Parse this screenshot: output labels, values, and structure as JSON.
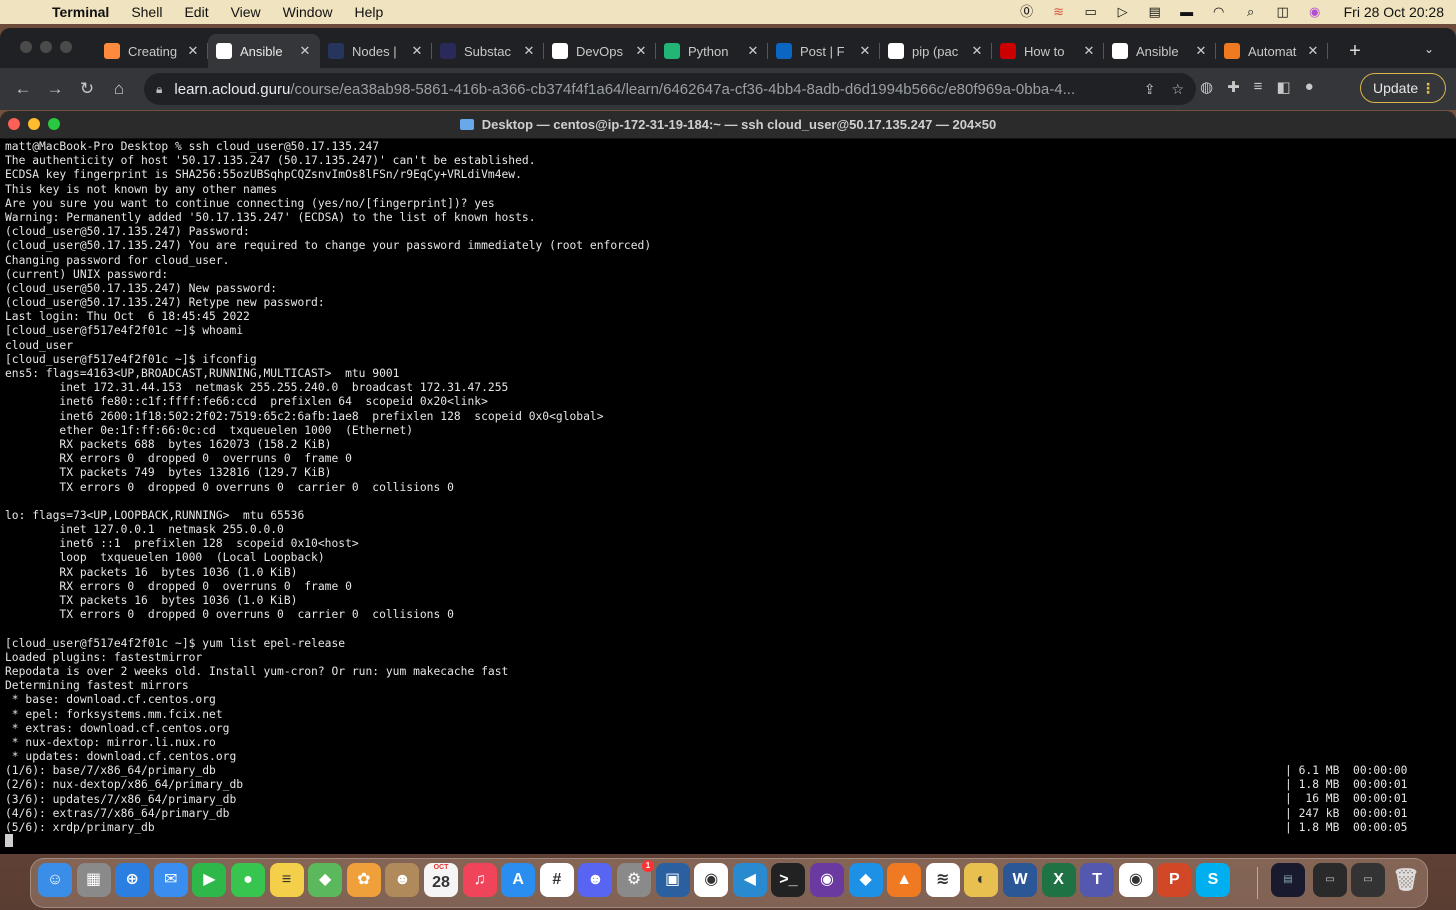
{
  "menubar": {
    "app": "Terminal",
    "menus": [
      "Shell",
      "Edit",
      "View",
      "Window",
      "Help"
    ],
    "clock": "Fri 28 Oct  20:28"
  },
  "browser": {
    "tabs": [
      {
        "label": "Creating",
        "favicon_color": "#ff8a3d",
        "icon": "cloud-icon",
        "active": false
      },
      {
        "label": "Ansible",
        "favicon_color": "#ffffff",
        "icon": "cloud-icon",
        "active": true
      },
      {
        "label": "Nodes |",
        "favicon_color": "#26355e",
        "icon": "nodes-icon",
        "active": false
      },
      {
        "label": "Substac",
        "favicon_color": "#2a2a5a",
        "icon": "substack-icon",
        "active": false
      },
      {
        "label": "DevOps",
        "favicon_color": "#ffffff",
        "icon": "devops-icon",
        "active": false
      },
      {
        "label": "Python",
        "favicon_color": "#23b576",
        "icon": "python-w-icon",
        "active": false
      },
      {
        "label": "Post | F",
        "favicon_color": "#0a66c2",
        "icon": "linkedin-icon",
        "active": false
      },
      {
        "label": "pip (pac",
        "favicon_color": "#ffffff",
        "icon": "wikipedia-icon",
        "active": false
      },
      {
        "label": "How to",
        "favicon_color": "#cc0000",
        "icon": "redhat-icon",
        "active": false
      },
      {
        "label": "Ansible",
        "favicon_color": "#ffffff",
        "icon": "n-icon",
        "active": false
      },
      {
        "label": "Automat",
        "favicon_color": "#f07a22",
        "icon": "box-icon",
        "active": false
      }
    ],
    "url_host": "learn.acloud.guru",
    "url_path": "/course/ea38ab98-5861-416b-a366-cb374f4f1a64/learn/6462647a-cf36-4bb4-8adb-d6d1994b566c/e80f969a-0bba-4...",
    "update_label": "Update"
  },
  "terminal": {
    "title": "Desktop — centos@ip-172-31-19-184:~ — ssh cloud_user@50.17.135.247 — 204×50",
    "lines": [
      "matt@MacBook-Pro Desktop % ssh cloud_user@50.17.135.247",
      "The authenticity of host '50.17.135.247 (50.17.135.247)' can't be established.",
      "ECDSA key fingerprint is SHA256:55ozUBSqhpCQZsnvImOs8lFSn/r9EqCy+VRLdiVm4ew.",
      "This key is not known by any other names",
      "Are you sure you want to continue connecting (yes/no/[fingerprint])? yes",
      "Warning: Permanently added '50.17.135.247' (ECDSA) to the list of known hosts.",
      "(cloud_user@50.17.135.247) Password:",
      "(cloud_user@50.17.135.247) You are required to change your password immediately (root enforced)",
      "Changing password for cloud_user.",
      "(current) UNIX password:",
      "(cloud_user@50.17.135.247) New password:",
      "(cloud_user@50.17.135.247) Retype new password:",
      "Last login: Thu Oct  6 18:45:45 2022",
      "[cloud_user@f517e4f2f01c ~]$ whoami",
      "cloud_user",
      "[cloud_user@f517e4f2f01c ~]$ ifconfig",
      "ens5: flags=4163<UP,BROADCAST,RUNNING,MULTICAST>  mtu 9001",
      "        inet 172.31.44.153  netmask 255.255.240.0  broadcast 172.31.47.255",
      "        inet6 fe80::c1f:ffff:fe66:ccd  prefixlen 64  scopeid 0x20<link>",
      "        inet6 2600:1f18:502:2f02:7519:65c2:6afb:1ae8  prefixlen 128  scopeid 0x0<global>",
      "        ether 0e:1f:ff:66:0c:cd  txqueuelen 1000  (Ethernet)",
      "        RX packets 688  bytes 162073 (158.2 KiB)",
      "        RX errors 0  dropped 0  overruns 0  frame 0",
      "        TX packets 749  bytes 132816 (129.7 KiB)",
      "        TX errors 0  dropped 0 overruns 0  carrier 0  collisions 0",
      "",
      "lo: flags=73<UP,LOOPBACK,RUNNING>  mtu 65536",
      "        inet 127.0.0.1  netmask 255.0.0.0",
      "        inet6 ::1  prefixlen 128  scopeid 0x10<host>",
      "        loop  txqueuelen 1000  (Local Loopback)",
      "        RX packets 16  bytes 1036 (1.0 KiB)",
      "        RX errors 0  dropped 0  overruns 0  frame 0",
      "        TX packets 16  bytes 1036 (1.0 KiB)",
      "        TX errors 0  dropped 0 overruns 0  carrier 0  collisions 0",
      "",
      "[cloud_user@f517e4f2f01c ~]$ yum list epel-release",
      "Loaded plugins: fastestmirror",
      "Repodata is over 2 weeks old. Install yum-cron? Or run: yum makecache fast",
      "Determining fastest mirrors",
      " * base: download.cf.centos.org",
      " * epel: forksystems.mm.fcix.net",
      " * extras: download.cf.centos.org",
      " * nux-dextop: mirror.li.nux.ro",
      " * updates: download.cf.centos.org",
      "(1/6): base/7/x86_64/primary_db",
      "(2/6): nux-dextop/x86_64/primary_db",
      "(3/6): updates/7/x86_64/primary_db",
      "(4/6): extras/7/x86_64/primary_db",
      "(5/6): xrdp/primary_db"
    ],
    "downloads": [
      "| 6.1 MB  00:00:00",
      "| 1.8 MB  00:00:01",
      "|  16 MB  00:00:01",
      "| 247 kB  00:00:01",
      "| 1.8 MB  00:00:05"
    ]
  },
  "dock": {
    "apps": [
      {
        "icon": "finder-icon",
        "color": "#3b8ee8",
        "glyph": "☺"
      },
      {
        "icon": "launchpad-icon",
        "color": "#8a8a8a",
        "glyph": "▦"
      },
      {
        "icon": "safari-icon",
        "color": "#2a7fe0",
        "glyph": "⊕"
      },
      {
        "icon": "mail-icon",
        "color": "#3a8ef0",
        "glyph": "✉"
      },
      {
        "icon": "facetime-icon",
        "color": "#2fb84a",
        "glyph": "▶"
      },
      {
        "icon": "messages-icon",
        "color": "#37c550",
        "glyph": "●"
      },
      {
        "icon": "notes-icon",
        "color": "#f4d04a",
        "glyph": "≡"
      },
      {
        "icon": "maps-icon",
        "color": "#5cb85c",
        "glyph": "◆"
      },
      {
        "icon": "photos-icon",
        "color": "#f0a03a",
        "glyph": "✿"
      },
      {
        "icon": "contacts-icon",
        "color": "#b08a5a",
        "glyph": "☻"
      },
      {
        "icon": "calendar-icon",
        "color": "#f5f5f5",
        "glyph": "28"
      },
      {
        "icon": "music-icon",
        "color": "#f0445a",
        "glyph": "♫"
      },
      {
        "icon": "appstore-icon",
        "color": "#2a8ef0",
        "glyph": "A"
      },
      {
        "icon": "slack-icon",
        "color": "#ffffff",
        "glyph": "#"
      },
      {
        "icon": "discord-icon",
        "color": "#5865f2",
        "glyph": "☻"
      },
      {
        "icon": "settings-icon",
        "color": "#8a8a8a",
        "glyph": "⚙"
      },
      {
        "icon": "virtualbox-icon",
        "color": "#2a60a0",
        "glyph": "▣"
      },
      {
        "icon": "redhat-icon",
        "color": "#ffffff",
        "glyph": "◉"
      },
      {
        "icon": "vscode-icon",
        "color": "#2a8ad0",
        "glyph": "◀"
      },
      {
        "icon": "terminal-icon",
        "color": "#222222",
        "glyph": ">_"
      },
      {
        "icon": "github-icon",
        "color": "#6a3aa0",
        "glyph": "◉"
      },
      {
        "icon": "docker-icon",
        "color": "#1d91e6",
        "glyph": "◆"
      },
      {
        "icon": "orange-icon",
        "color": "#f07a22",
        "glyph": "▲"
      },
      {
        "icon": "wave-icon",
        "color": "#ffffff",
        "glyph": "≋"
      },
      {
        "icon": "chrome-canary-icon",
        "color": "#e8c050",
        "glyph": "◐"
      },
      {
        "icon": "word-icon",
        "color": "#2b5797",
        "glyph": "W"
      },
      {
        "icon": "excel-icon",
        "color": "#1f7244",
        "glyph": "X"
      },
      {
        "icon": "teams-icon",
        "color": "#5558af",
        "glyph": "T"
      },
      {
        "icon": "chrome-icon",
        "color": "#ffffff",
        "glyph": "◉"
      },
      {
        "icon": "powerpoint-icon",
        "color": "#d24726",
        "glyph": "P"
      },
      {
        "icon": "skype-icon",
        "color": "#00aff0",
        "glyph": "S"
      }
    ],
    "calendar_month": "OCT",
    "settings_badge": "1"
  }
}
